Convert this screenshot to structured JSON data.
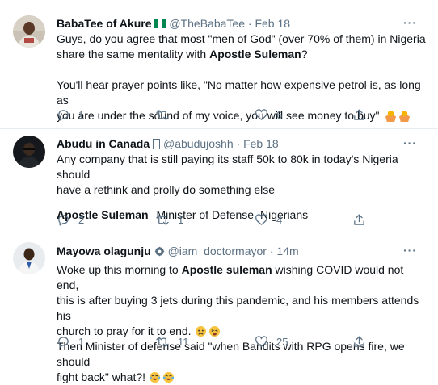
{
  "tweets": [
    {
      "name": "BabaTee of Akure",
      "handle": "@TheBabaTee",
      "dot": "·",
      "time": "Feb 18",
      "more": "···",
      "text1_a": "Guys, do you agree that most \"men of God\" (over 70% of them) in Nigeria",
      "text1_b": "share the same mentality with ",
      "text1_bold": "Apostle Suleman",
      "text1_c": "?",
      "text2_a": "You'll hear prayer points like, \"No matter how expensive petrol is,  as long as",
      "text2_b": "you are under the sound of my voice, you will see money to buy\"",
      "reply_count": "1",
      "retweet_count": "",
      "like_count": "6",
      "icons": [
        "nigeria-flag-icon",
        "reply-icon",
        "retweet-icon",
        "like-icon",
        "share-icon"
      ]
    },
    {
      "name": "Abudu in Canada",
      "handle": "@abudujoshh",
      "dot": "·",
      "time": "Feb 18",
      "more": "···",
      "text1_a": "Any company that is still paying its staff 50k to 80k in today's Nigeria should",
      "text1_b": "have a rethink and prolly do something else",
      "mention1": "Apostle Suleman",
      "mention2": "Minister of Defense",
      "mention3": "Nigerians",
      "reply_count": "2",
      "retweet_count": "1",
      "like_count": "4"
    },
    {
      "name": "Mayowa olagunju",
      "handle": "@iam_doctormayor",
      "dot": "·",
      "time": "14m",
      "more": "···",
      "line1_a": "Woke up this morning to ",
      "line1_bold": "Apostle suleman",
      "line1_c": " wishing COVID would not end,",
      "line2": "this is after buying 3 jets during this pandemic, and his members attends his",
      "line3": "church to pray for it to end.",
      "line4": "Then Minister of defense said \"when Bandits with RPG opens fire, we should",
      "line5": "fight back\" what?!",
      "reply_count": "1",
      "retweet_count": "11",
      "like_count": "25"
    }
  ],
  "colors": {
    "text": "#0f1419",
    "secondary": "#5b7083",
    "divider": "#e6ecf0",
    "flag_green": "#008751"
  }
}
